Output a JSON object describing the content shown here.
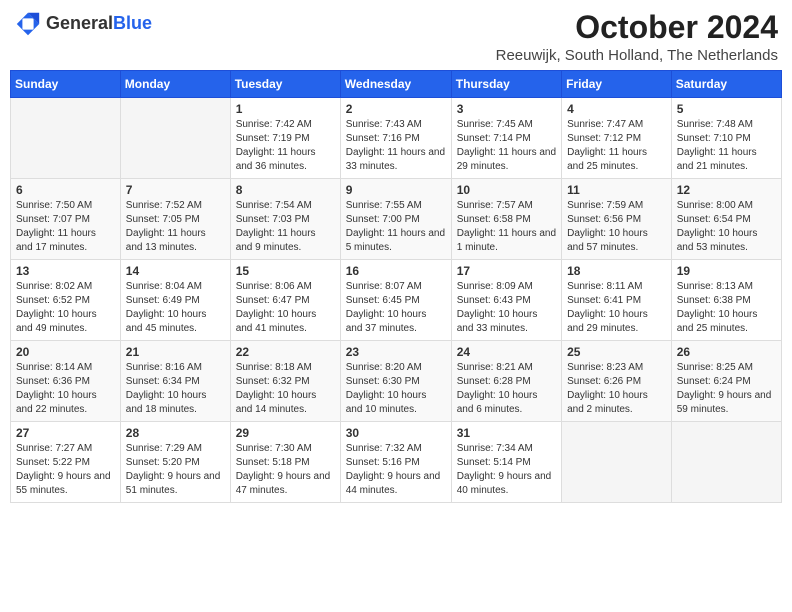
{
  "header": {
    "logo_general": "General",
    "logo_blue": "Blue",
    "month": "October 2024",
    "location": "Reeuwijk, South Holland, The Netherlands"
  },
  "weekdays": [
    "Sunday",
    "Monday",
    "Tuesday",
    "Wednesday",
    "Thursday",
    "Friday",
    "Saturday"
  ],
  "weeks": [
    [
      {
        "day": "",
        "sunrise": "",
        "sunset": "",
        "daylight": ""
      },
      {
        "day": "",
        "sunrise": "",
        "sunset": "",
        "daylight": ""
      },
      {
        "day": "1",
        "sunrise": "Sunrise: 7:42 AM",
        "sunset": "Sunset: 7:19 PM",
        "daylight": "Daylight: 11 hours and 36 minutes."
      },
      {
        "day": "2",
        "sunrise": "Sunrise: 7:43 AM",
        "sunset": "Sunset: 7:16 PM",
        "daylight": "Daylight: 11 hours and 33 minutes."
      },
      {
        "day": "3",
        "sunrise": "Sunrise: 7:45 AM",
        "sunset": "Sunset: 7:14 PM",
        "daylight": "Daylight: 11 hours and 29 minutes."
      },
      {
        "day": "4",
        "sunrise": "Sunrise: 7:47 AM",
        "sunset": "Sunset: 7:12 PM",
        "daylight": "Daylight: 11 hours and 25 minutes."
      },
      {
        "day": "5",
        "sunrise": "Sunrise: 7:48 AM",
        "sunset": "Sunset: 7:10 PM",
        "daylight": "Daylight: 11 hours and 21 minutes."
      }
    ],
    [
      {
        "day": "6",
        "sunrise": "Sunrise: 7:50 AM",
        "sunset": "Sunset: 7:07 PM",
        "daylight": "Daylight: 11 hours and 17 minutes."
      },
      {
        "day": "7",
        "sunrise": "Sunrise: 7:52 AM",
        "sunset": "Sunset: 7:05 PM",
        "daylight": "Daylight: 11 hours and 13 minutes."
      },
      {
        "day": "8",
        "sunrise": "Sunrise: 7:54 AM",
        "sunset": "Sunset: 7:03 PM",
        "daylight": "Daylight: 11 hours and 9 minutes."
      },
      {
        "day": "9",
        "sunrise": "Sunrise: 7:55 AM",
        "sunset": "Sunset: 7:00 PM",
        "daylight": "Daylight: 11 hours and 5 minutes."
      },
      {
        "day": "10",
        "sunrise": "Sunrise: 7:57 AM",
        "sunset": "Sunset: 6:58 PM",
        "daylight": "Daylight: 11 hours and 1 minute."
      },
      {
        "day": "11",
        "sunrise": "Sunrise: 7:59 AM",
        "sunset": "Sunset: 6:56 PM",
        "daylight": "Daylight: 10 hours and 57 minutes."
      },
      {
        "day": "12",
        "sunrise": "Sunrise: 8:00 AM",
        "sunset": "Sunset: 6:54 PM",
        "daylight": "Daylight: 10 hours and 53 minutes."
      }
    ],
    [
      {
        "day": "13",
        "sunrise": "Sunrise: 8:02 AM",
        "sunset": "Sunset: 6:52 PM",
        "daylight": "Daylight: 10 hours and 49 minutes."
      },
      {
        "day": "14",
        "sunrise": "Sunrise: 8:04 AM",
        "sunset": "Sunset: 6:49 PM",
        "daylight": "Daylight: 10 hours and 45 minutes."
      },
      {
        "day": "15",
        "sunrise": "Sunrise: 8:06 AM",
        "sunset": "Sunset: 6:47 PM",
        "daylight": "Daylight: 10 hours and 41 minutes."
      },
      {
        "day": "16",
        "sunrise": "Sunrise: 8:07 AM",
        "sunset": "Sunset: 6:45 PM",
        "daylight": "Daylight: 10 hours and 37 minutes."
      },
      {
        "day": "17",
        "sunrise": "Sunrise: 8:09 AM",
        "sunset": "Sunset: 6:43 PM",
        "daylight": "Daylight: 10 hours and 33 minutes."
      },
      {
        "day": "18",
        "sunrise": "Sunrise: 8:11 AM",
        "sunset": "Sunset: 6:41 PM",
        "daylight": "Daylight: 10 hours and 29 minutes."
      },
      {
        "day": "19",
        "sunrise": "Sunrise: 8:13 AM",
        "sunset": "Sunset: 6:38 PM",
        "daylight": "Daylight: 10 hours and 25 minutes."
      }
    ],
    [
      {
        "day": "20",
        "sunrise": "Sunrise: 8:14 AM",
        "sunset": "Sunset: 6:36 PM",
        "daylight": "Daylight: 10 hours and 22 minutes."
      },
      {
        "day": "21",
        "sunrise": "Sunrise: 8:16 AM",
        "sunset": "Sunset: 6:34 PM",
        "daylight": "Daylight: 10 hours and 18 minutes."
      },
      {
        "day": "22",
        "sunrise": "Sunrise: 8:18 AM",
        "sunset": "Sunset: 6:32 PM",
        "daylight": "Daylight: 10 hours and 14 minutes."
      },
      {
        "day": "23",
        "sunrise": "Sunrise: 8:20 AM",
        "sunset": "Sunset: 6:30 PM",
        "daylight": "Daylight: 10 hours and 10 minutes."
      },
      {
        "day": "24",
        "sunrise": "Sunrise: 8:21 AM",
        "sunset": "Sunset: 6:28 PM",
        "daylight": "Daylight: 10 hours and 6 minutes."
      },
      {
        "day": "25",
        "sunrise": "Sunrise: 8:23 AM",
        "sunset": "Sunset: 6:26 PM",
        "daylight": "Daylight: 10 hours and 2 minutes."
      },
      {
        "day": "26",
        "sunrise": "Sunrise: 8:25 AM",
        "sunset": "Sunset: 6:24 PM",
        "daylight": "Daylight: 9 hours and 59 minutes."
      }
    ],
    [
      {
        "day": "27",
        "sunrise": "Sunrise: 7:27 AM",
        "sunset": "Sunset: 5:22 PM",
        "daylight": "Daylight: 9 hours and 55 minutes."
      },
      {
        "day": "28",
        "sunrise": "Sunrise: 7:29 AM",
        "sunset": "Sunset: 5:20 PM",
        "daylight": "Daylight: 9 hours and 51 minutes."
      },
      {
        "day": "29",
        "sunrise": "Sunrise: 7:30 AM",
        "sunset": "Sunset: 5:18 PM",
        "daylight": "Daylight: 9 hours and 47 minutes."
      },
      {
        "day": "30",
        "sunrise": "Sunrise: 7:32 AM",
        "sunset": "Sunset: 5:16 PM",
        "daylight": "Daylight: 9 hours and 44 minutes."
      },
      {
        "day": "31",
        "sunrise": "Sunrise: 7:34 AM",
        "sunset": "Sunset: 5:14 PM",
        "daylight": "Daylight: 9 hours and 40 minutes."
      },
      {
        "day": "",
        "sunrise": "",
        "sunset": "",
        "daylight": ""
      },
      {
        "day": "",
        "sunrise": "",
        "sunset": "",
        "daylight": ""
      }
    ]
  ]
}
